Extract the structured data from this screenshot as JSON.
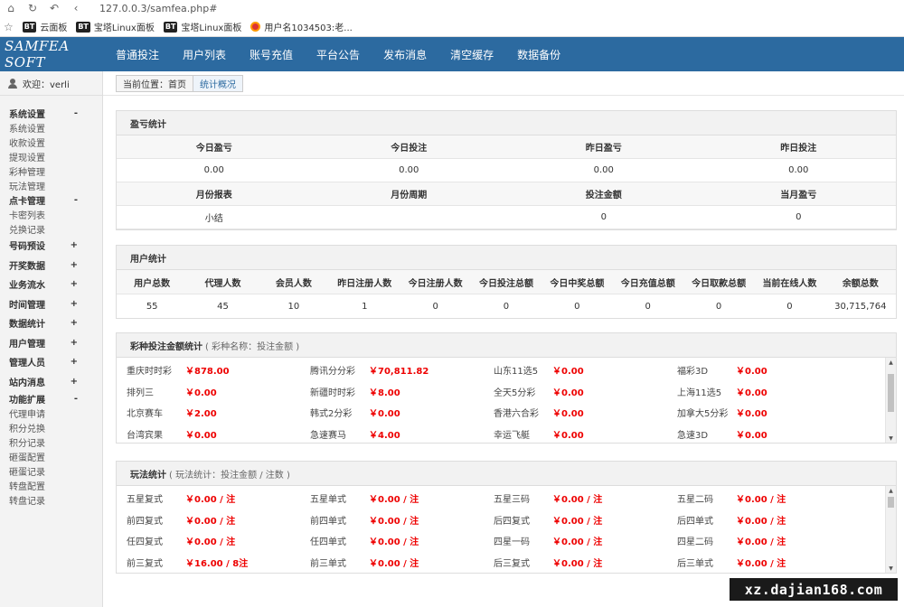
{
  "browser": {
    "url": "127.0.0.3/samfea.php#",
    "bookmarks": [
      {
        "badge": "BT",
        "label": "云面板"
      },
      {
        "badge": "BT",
        "label": "宝塔Linux面板"
      },
      {
        "badge": "BT",
        "label": "宝塔Linux面板"
      },
      {
        "badge": "",
        "label": "用户名1034503:老..."
      }
    ]
  },
  "header": {
    "logo": "SAMFEA SOFT",
    "menu": [
      "普通投注",
      "用户列表",
      "账号充值",
      "平台公告",
      "发布消息",
      "清空缓存",
      "数据备份"
    ]
  },
  "sidebar": {
    "welcome": "欢迎：verli",
    "groups": [
      {
        "title": "系统设置",
        "toggle": "-",
        "items": [
          "系统设置",
          "收款设置",
          "提现设置",
          "彩种管理",
          "玩法管理"
        ]
      },
      {
        "title": "点卡管理",
        "toggle": "-",
        "items": [
          "卡密列表",
          "兑换记录"
        ]
      },
      {
        "title": "号码预设",
        "toggle": "+",
        "items": []
      },
      {
        "title": "开奖数据",
        "toggle": "+",
        "items": []
      },
      {
        "title": "业务流水",
        "toggle": "+",
        "items": []
      },
      {
        "title": "时间管理",
        "toggle": "+",
        "items": []
      },
      {
        "title": "数据统计",
        "toggle": "+",
        "items": []
      },
      {
        "title": "用户管理",
        "toggle": "+",
        "items": []
      },
      {
        "title": "管理人员",
        "toggle": "+",
        "items": []
      },
      {
        "title": "站内消息",
        "toggle": "+",
        "items": []
      },
      {
        "title": "功能扩展",
        "toggle": "-",
        "items": [
          "代理申请",
          "积分兑换",
          "积分记录",
          "砸蛋配置",
          "砸蛋记录",
          "转盘配置",
          "转盘记录"
        ]
      }
    ]
  },
  "breadcrumb": {
    "path": "当前位置：首页",
    "current": "统计概况"
  },
  "profit": {
    "title": "盈亏统计",
    "headers1": [
      "今日盈亏",
      "今日投注",
      "昨日盈亏",
      "昨日投注"
    ],
    "values1": [
      "0.00",
      "0.00",
      "0.00",
      "0.00"
    ],
    "headers2": [
      "月份报表",
      "月份周期",
      "投注金额",
      "当月盈亏"
    ],
    "values2": [
      "小结",
      "",
      "0",
      "0"
    ]
  },
  "users": {
    "title": "用户统计",
    "headers": [
      "用户总数",
      "代理人数",
      "会员人数",
      "昨日注册人数",
      "今日注册人数",
      "今日投注总额",
      "今日中奖总额",
      "今日充值总额",
      "今日取款总额",
      "当前在线人数",
      "余额总数"
    ],
    "values": [
      "55",
      "45",
      "10",
      "1",
      "0",
      "0",
      "0",
      "0",
      "0",
      "0",
      "30,715,764"
    ]
  },
  "lottery": {
    "title": "彩种投注金额统计",
    "subtitle": "( 彩种名称：投注金额 )",
    "items": [
      {
        "name": "重庆时时彩",
        "amount": "￥878.00"
      },
      {
        "name": "腾讯分分彩",
        "amount": "￥70,811.82"
      },
      {
        "name": "山东11选5",
        "amount": "￥0.00"
      },
      {
        "name": "福彩3D",
        "amount": "￥0.00"
      },
      {
        "name": "排列三",
        "amount": "￥0.00"
      },
      {
        "name": "新疆时时彩",
        "amount": "￥8.00"
      },
      {
        "name": "全天5分彩",
        "amount": "￥0.00"
      },
      {
        "name": "上海11选5",
        "amount": "￥0.00"
      },
      {
        "name": "北京赛车",
        "amount": "￥2.00"
      },
      {
        "name": "韩式2分彩",
        "amount": "￥0.00"
      },
      {
        "name": "香港六合彩",
        "amount": "￥0.00"
      },
      {
        "name": "加拿大5分彩",
        "amount": "￥0.00"
      },
      {
        "name": "台湾宾果",
        "amount": "￥0.00"
      },
      {
        "name": "急速赛马",
        "amount": "￥4.00"
      },
      {
        "name": "幸运飞艇",
        "amount": "￥0.00"
      },
      {
        "name": "急速3D",
        "amount": "￥0.00"
      }
    ]
  },
  "plays": {
    "title": "玩法统计",
    "subtitle": "( 玩法统计：投注金额 / 注数 )",
    "items": [
      {
        "name": "五星复式",
        "amount": "￥0.00 / 注"
      },
      {
        "name": "五星单式",
        "amount": "￥0.00 / 注"
      },
      {
        "name": "五星三码",
        "amount": "￥0.00 / 注"
      },
      {
        "name": "五星二码",
        "amount": "￥0.00 / 注"
      },
      {
        "name": "前四复式",
        "amount": "￥0.00 / 注"
      },
      {
        "name": "前四单式",
        "amount": "￥0.00 / 注"
      },
      {
        "name": "后四复式",
        "amount": "￥0.00 / 注"
      },
      {
        "name": "后四单式",
        "amount": "￥0.00 / 注"
      },
      {
        "name": "任四复式",
        "amount": "￥0.00 / 注"
      },
      {
        "name": "任四单式",
        "amount": "￥0.00 / 注"
      },
      {
        "name": "四星一码",
        "amount": "￥0.00 / 注"
      },
      {
        "name": "四星二码",
        "amount": "￥0.00 / 注"
      },
      {
        "name": "前三复式",
        "amount": "￥16.00 / 8注"
      },
      {
        "name": "前三单式",
        "amount": "￥0.00 / 注"
      },
      {
        "name": "后三复式",
        "amount": "￥0.00 / 注"
      },
      {
        "name": "后三单式",
        "amount": "￥0.00 / 注"
      }
    ]
  },
  "watermark": "xz.dajian168.com",
  "colors": {
    "nav": "#2c6aa0",
    "amount": "#e00000",
    "sidebar": "#f3f3f3"
  }
}
